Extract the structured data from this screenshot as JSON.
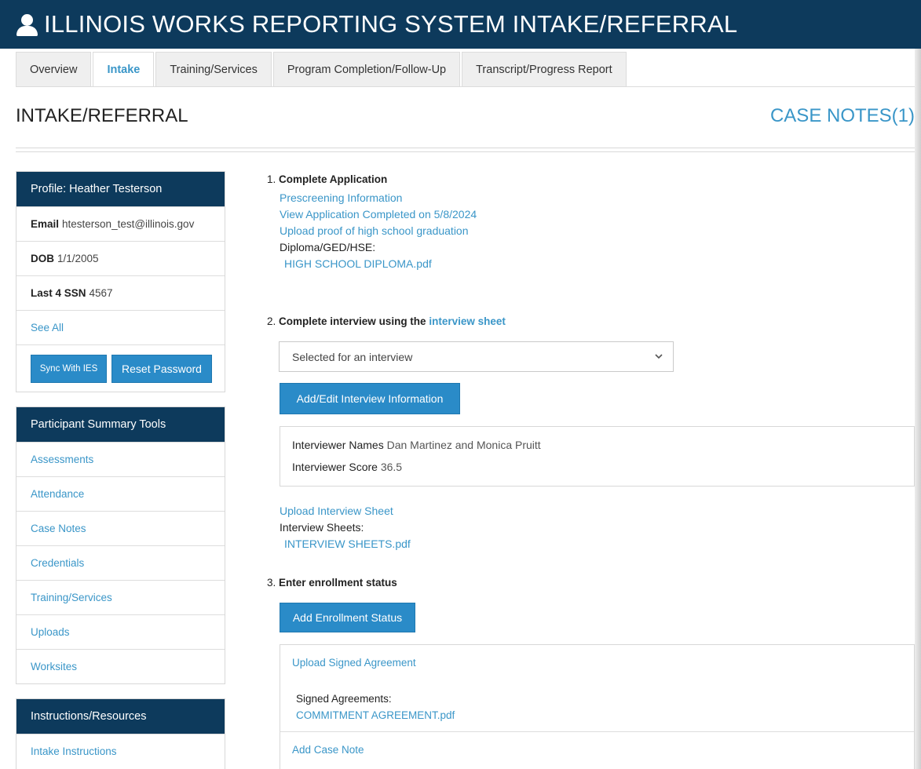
{
  "header": {
    "title": "ILLINOIS WORKS REPORTING SYSTEM INTAKE/REFERRAL",
    "icon": "user-icon"
  },
  "tabs": [
    {
      "label": "Overview",
      "active": false
    },
    {
      "label": "Intake",
      "active": true
    },
    {
      "label": "Training/Services",
      "active": false
    },
    {
      "label": "Program Completion/Follow-Up",
      "active": false
    },
    {
      "label": "Transcript/Progress Report",
      "active": false
    }
  ],
  "page": {
    "title": "INTAKE/REFERRAL",
    "case_notes": "CASE NOTES(1)"
  },
  "profile": {
    "heading": "Profile: Heather Testerson",
    "email_label": "Email",
    "email": "htesterson_test@illinois.gov",
    "dob_label": "DOB",
    "dob": "1/1/2005",
    "ssn_label": "Last 4 SSN",
    "ssn": "4567",
    "see_all": "See All",
    "sync_button": "Sync With IES",
    "reset_button": "Reset Password"
  },
  "tools": {
    "heading": "Participant Summary Tools",
    "items": [
      "Assessments",
      "Attendance",
      "Case Notes",
      "Credentials",
      "Training/Services",
      "Uploads",
      "Worksites"
    ]
  },
  "instructions": {
    "heading": "Instructions/Resources",
    "items": [
      "Intake Instructions"
    ]
  },
  "step1": {
    "number": "1.",
    "title": "Complete Application",
    "link1": "Prescreening Information",
    "link2": "View Application Completed on 5/8/2024",
    "link3": "Upload proof of high school graduation",
    "diploma_label": "Diploma/GED/HSE:",
    "diploma_file": "HIGH SCHOOL DIPLOMA.pdf"
  },
  "step2": {
    "number": "2.",
    "title": "Complete interview using the",
    "title_link": "interview sheet",
    "select_value": "Selected for an interview",
    "edit_button": "Add/Edit Interview Information",
    "names_label": "Interviewer Names",
    "names": "Dan Martinez and Monica Pruitt",
    "score_label": "Interviewer Score",
    "score": "36.5",
    "upload_link": "Upload Interview Sheet",
    "sheets_label": "Interview Sheets:",
    "sheets_file": "INTERVIEW SHEETS.pdf"
  },
  "step3": {
    "number": "3.",
    "title": "Enter enrollment status",
    "add_button": "Add Enrollment Status",
    "upload_link": "Upload Signed Agreement",
    "agreements_label": "Signed Agreements:",
    "agreement_file": "COMMITMENT AGREEMENT.pdf",
    "case_note_link": "Add Case Note"
  }
}
